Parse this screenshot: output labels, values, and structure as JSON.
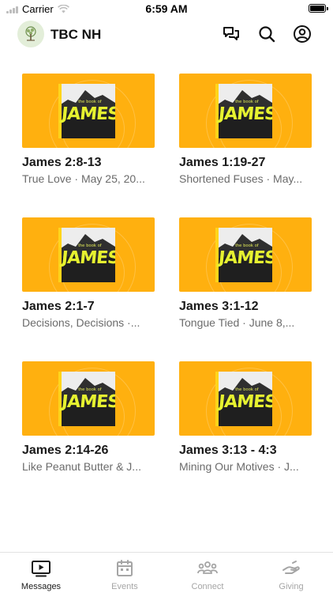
{
  "status_bar": {
    "carrier": "Carrier",
    "time": "6:59 AM"
  },
  "header": {
    "title": "TBC NH",
    "icons": [
      "chat-icon",
      "search-icon",
      "account-icon"
    ]
  },
  "series_art": {
    "small_text": "the book of",
    "big_text": "JAMES"
  },
  "messages": [
    {
      "title": "James 2:8-13",
      "subtitle": "True Love · May 25, 20..."
    },
    {
      "title": "James 1:19-27",
      "subtitle": "Shortened Fuses · May..."
    },
    {
      "title": "James 2:1-7",
      "subtitle": "Decisions, Decisions ·..."
    },
    {
      "title": "James 3:1-12",
      "subtitle": "Tongue Tied · June 8,..."
    },
    {
      "title": "James 2:14-26",
      "subtitle": "Like Peanut Butter & J..."
    },
    {
      "title": "James 3:13 - 4:3",
      "subtitle": "Mining Our Motives · J..."
    }
  ],
  "tabs": [
    {
      "label": "Messages",
      "icon": "video-icon",
      "active": true
    },
    {
      "label": "Events",
      "icon": "calendar-icon",
      "active": false
    },
    {
      "label": "Connect",
      "icon": "people-icon",
      "active": false
    },
    {
      "label": "Giving",
      "icon": "giving-hand-icon",
      "active": false
    }
  ],
  "colors": {
    "accent": "#ffb00f",
    "title_text": "#e6f230",
    "inactive_tab": "#a5a5a5"
  }
}
